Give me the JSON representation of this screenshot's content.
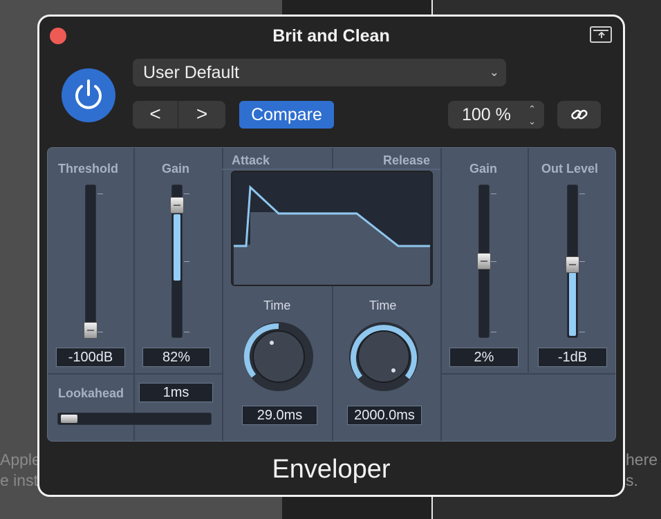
{
  "background": {
    "left_text": "Apple",
    "left_text_2": "e inst",
    "right_text": "here",
    "right_text_2": "s."
  },
  "window": {
    "title": "Brit and Clean",
    "footer_title": "Enveloper"
  },
  "header": {
    "preset_label": "User Default",
    "compare_label": "Compare",
    "zoom_value": "100 %",
    "prev_label": "<",
    "next_label": ">"
  },
  "colors": {
    "accent": "#2f6fd0",
    "panel": "#4b5668",
    "fill": "#94cdf5",
    "close": "#ee5b54"
  },
  "controls": {
    "threshold": {
      "label": "Threshold",
      "value": "-100dB",
      "level": 0.0
    },
    "gain_left": {
      "label": "Gain",
      "value": "82%",
      "level": 0.82
    },
    "attack": {
      "label": "Attack",
      "time_label": "Time",
      "value": "29.0ms"
    },
    "release": {
      "label": "Release",
      "time_label": "Time",
      "value": "2000.0ms"
    },
    "gain_right": {
      "label": "Gain",
      "value": "2%",
      "level": 0.5
    },
    "out_level": {
      "label": "Out Level",
      "value": "-1dB",
      "level": 0.48
    },
    "lookahead": {
      "label": "Lookahead",
      "value": "1ms",
      "level": 0.05
    }
  },
  "icons": {
    "close": "close-icon",
    "popout": "popout-icon",
    "power": "power-icon",
    "link": "link-icon",
    "chevron": "chevron-down-icon"
  }
}
